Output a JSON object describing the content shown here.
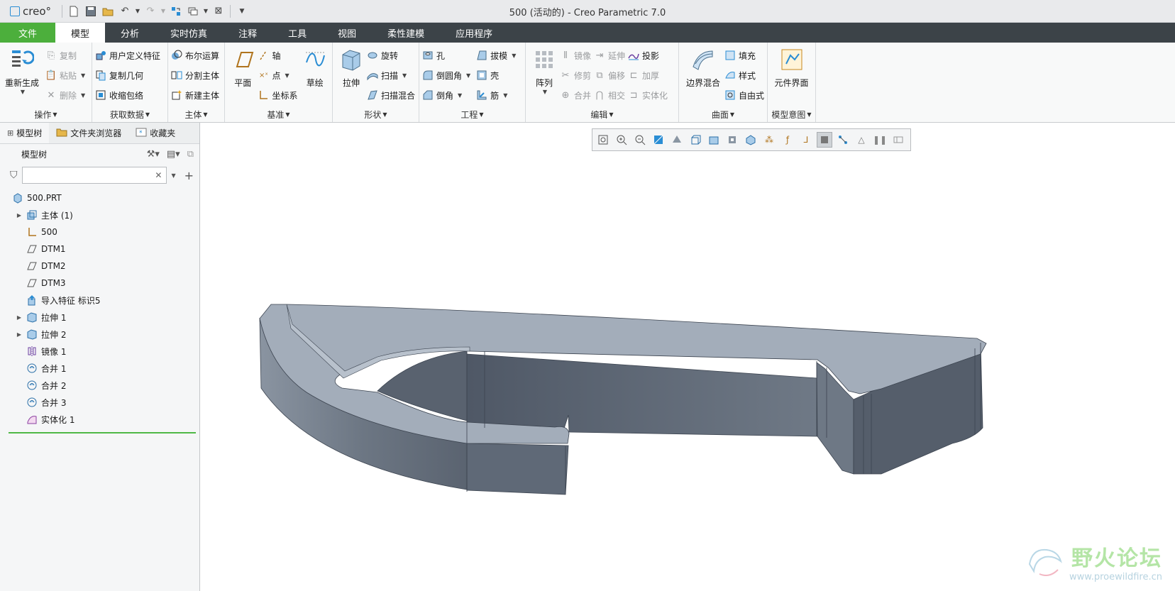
{
  "app": {
    "logo_text": "creo°",
    "title": "500 (活动的) - Creo Parametric 7.0"
  },
  "tabs": [
    {
      "label": "文件",
      "kind": "file"
    },
    {
      "label": "模型",
      "kind": "active"
    },
    {
      "label": "分析"
    },
    {
      "label": "实时仿真"
    },
    {
      "label": "注释"
    },
    {
      "label": "工具"
    },
    {
      "label": "视图"
    },
    {
      "label": "柔性建模"
    },
    {
      "label": "应用程序"
    }
  ],
  "ribbon": {
    "operations": {
      "label": "操作",
      "regenerate": "重新生成",
      "copy": "复制",
      "paste": "粘贴",
      "delete": "删除"
    },
    "get_data": {
      "label": "获取数据",
      "udf": "用户定义特征",
      "copy_geom": "复制几何",
      "shrinkwrap": "收缩包络"
    },
    "body": {
      "label": "主体",
      "boolean": "布尔运算",
      "split": "分割主体",
      "new_body": "新建主体"
    },
    "datum": {
      "label": "基准",
      "plane": "平面",
      "axis": "轴",
      "point": "点",
      "csys": "坐标系",
      "sketch": "草绘"
    },
    "shapes": {
      "label": "形状",
      "extrude": "拉伸",
      "revolve": "旋转",
      "sweep": "扫描",
      "swept_blend": "扫描混合"
    },
    "engineering": {
      "label": "工程",
      "hole": "孔",
      "draft": "拔模",
      "round": "倒圆角",
      "shell": "壳",
      "chamfer": "倒角",
      "rib": "筋"
    },
    "editing": {
      "label": "编辑",
      "pattern": "阵列",
      "mirror": "镜像",
      "extend": "延伸",
      "project": "投影",
      "trim": "修剪",
      "offset": "偏移",
      "thicken": "加厚",
      "merge": "合并",
      "intersect": "相交",
      "solidify": "实体化"
    },
    "surfaces": {
      "label": "曲面",
      "boundary_blend": "边界混合",
      "fill": "填充",
      "style": "样式",
      "freestyle": "自由式"
    },
    "model_intent": {
      "label": "模型意图",
      "component_interface": "元件界面"
    }
  },
  "navigator": {
    "tabs": [
      "模型树",
      "文件夹浏览器",
      "收藏夹"
    ],
    "header": "模型树",
    "filter_placeholder": "",
    "items": [
      {
        "label": "500.PRT",
        "icon": "part-icon",
        "expandable": false,
        "indent": 0
      },
      {
        "label": "主体 (1)",
        "icon": "body-icon",
        "expandable": true,
        "indent": 1
      },
      {
        "label": "500",
        "icon": "csys-icon",
        "expandable": false,
        "indent": 1
      },
      {
        "label": "DTM1",
        "icon": "datum-plane-icon",
        "expandable": false,
        "indent": 1
      },
      {
        "label": "DTM2",
        "icon": "datum-plane-icon",
        "expandable": false,
        "indent": 1
      },
      {
        "label": "DTM3",
        "icon": "datum-plane-icon",
        "expandable": false,
        "indent": 1
      },
      {
        "label": "导入特征 标识5",
        "icon": "import-feature-icon",
        "expandable": false,
        "indent": 1
      },
      {
        "label": "拉伸 1",
        "icon": "extrude-icon",
        "expandable": true,
        "indent": 1
      },
      {
        "label": "拉伸 2",
        "icon": "extrude-icon",
        "expandable": true,
        "indent": 1
      },
      {
        "label": "镜像 1",
        "icon": "mirror-icon",
        "expandable": false,
        "indent": 1
      },
      {
        "label": "合并 1",
        "icon": "merge-icon",
        "expandable": false,
        "indent": 1
      },
      {
        "label": "合并 2",
        "icon": "merge-icon",
        "expandable": false,
        "indent": 1
      },
      {
        "label": "合并 3",
        "icon": "merge-icon",
        "expandable": false,
        "indent": 1
      },
      {
        "label": "实体化 1",
        "icon": "solidify-icon",
        "expandable": false,
        "indent": 1
      }
    ]
  },
  "watermark": {
    "name": "野火论坛",
    "url": "www.proewildfire.cn"
  },
  "colors": {
    "tabbar": "#3c4348",
    "file_tab": "#4caf3c",
    "accent": "#2a8dd4",
    "model_top": "#a3adba",
    "model_side": "#6a7482"
  }
}
